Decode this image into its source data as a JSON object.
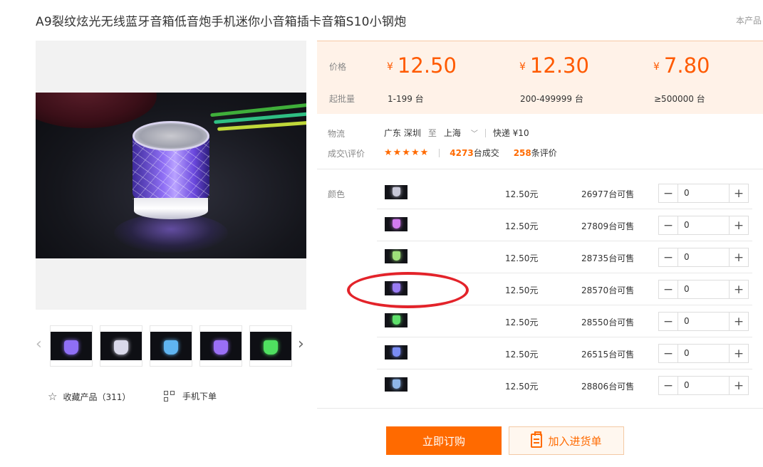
{
  "product": {
    "title": "A9裂纹炫光无线蓝牙音箱低音炮手机迷你小音箱插卡音箱S10小钢炮",
    "side_note": "本产品"
  },
  "pricing": {
    "price_label": "价格",
    "qty_label": "起批量",
    "currency": "¥",
    "tiers": [
      {
        "price": "12.50",
        "range": "1-199 台"
      },
      {
        "price": "12.30",
        "range": "200-499999 台"
      },
      {
        "price": "7.80",
        "range": "≥500000 台"
      }
    ],
    "accent_color": "#ff5a00"
  },
  "logistics": {
    "label": "物流",
    "from": "广东 深圳",
    "to_word": "至",
    "to": "上海",
    "shipping": "快递 ¥10"
  },
  "deals": {
    "label": "成交\\评价",
    "rating_stars": "★★★★★",
    "rating": 4.5,
    "sold_count": "4273",
    "sold_suffix": "台成交",
    "review_count": "258",
    "review_suffix": "条评价"
  },
  "color_label": "颜色",
  "skus": [
    {
      "price": "12.50元",
      "stock": "26977",
      "stock_suffix": "台可售",
      "qty": "0",
      "tint": "#c8c8d8"
    },
    {
      "price": "12.50元",
      "stock": "27809",
      "stock_suffix": "台可售",
      "qty": "0",
      "tint": "#d27cf0"
    },
    {
      "price": "12.50元",
      "stock": "28735",
      "stock_suffix": "台可售",
      "qty": "0",
      "tint": "#9ee07a"
    },
    {
      "price": "12.50元",
      "stock": "28570",
      "stock_suffix": "台可售",
      "qty": "0",
      "tint": "#9a7cf5"
    },
    {
      "price": "12.50元",
      "stock": "28550",
      "stock_suffix": "台可售",
      "qty": "0",
      "tint": "#5ee06a"
    },
    {
      "price": "12.50元",
      "stock": "26515",
      "stock_suffix": "台可售",
      "qty": "0",
      "tint": "#7a8cf5"
    },
    {
      "price": "12.50元",
      "stock": "28806",
      "stock_suffix": "台可售",
      "qty": "0",
      "tint": "#8fb6e8"
    }
  ],
  "gallery": {
    "thumb_tints": [
      "#8f6ff5",
      "#d9d9ea",
      "#5fb4f0",
      "#9a6ff5",
      "#4fe060"
    ]
  },
  "actions": {
    "favorite": "收藏产品（311）",
    "mobile_order": "手机下单",
    "buy_now": "立即订购",
    "add_to_cart": "加入进货单"
  },
  "stepper": {
    "minus": "−",
    "plus": "+"
  }
}
